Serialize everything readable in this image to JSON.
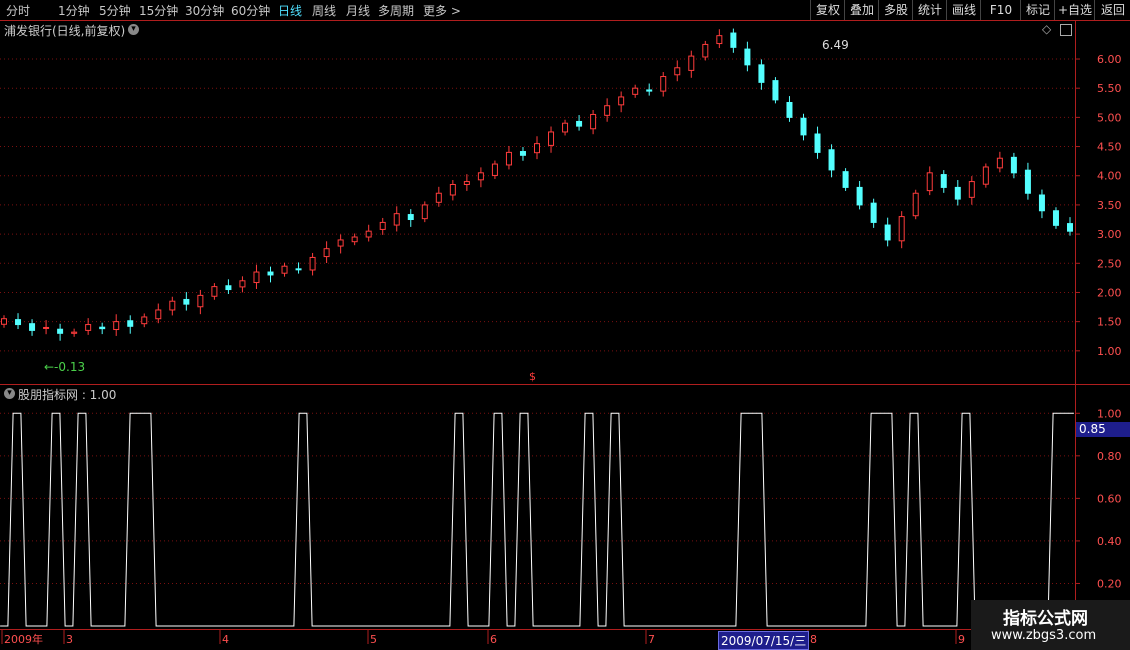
{
  "toolbar": {
    "periods": [
      {
        "label": "分时",
        "active": false
      },
      {
        "label": "1分钟",
        "active": false
      },
      {
        "label": "5分钟",
        "active": false
      },
      {
        "label": "15分钟",
        "active": false
      },
      {
        "label": "30分钟",
        "active": false
      },
      {
        "label": "60分钟",
        "active": false
      },
      {
        "label": "日线",
        "active": true
      },
      {
        "label": "周线",
        "active": false
      },
      {
        "label": "月线",
        "active": false
      },
      {
        "label": "多周期",
        "active": false
      }
    ],
    "more": "更多 >",
    "actions": [
      "复权",
      "叠加",
      "多股",
      "统计",
      "画线",
      "F10",
      "标记",
      "+自选",
      "返回"
    ]
  },
  "main_chart": {
    "title": "浦发银行(日线,前复权)",
    "high_label": "6.49",
    "low_label": "←-0.13",
    "marker": "$",
    "y_ticks": [
      "6.00",
      "5.50",
      "5.00",
      "4.50",
      "4.00",
      "3.50",
      "3.00",
      "2.50",
      "2.00",
      "1.50",
      "1.00"
    ]
  },
  "indicator": {
    "title": "股朋指标网 : 1.00",
    "current_value": "0.85",
    "y_ticks": [
      "1.00",
      "0.80",
      "0.60",
      "0.40",
      "0.20"
    ]
  },
  "time_axis": {
    "labels": [
      "2009年",
      "3",
      "4",
      "5",
      "6",
      "7",
      "8",
      "9"
    ],
    "cursor_label": "2009/07/15/三"
  },
  "watermark": {
    "line1": "指标公式网",
    "line2": "www.zbgs3.com"
  },
  "colors": {
    "up": "#ff3c3c",
    "down": "#54ffff",
    "grid": "#7a1010",
    "axis": "#b01e1e",
    "indicator_line": "#ffffff",
    "cursor_bg": "#1e1e8c"
  },
  "chart_data": [
    {
      "type": "candlestick",
      "title": "浦发银行(日线,前复权)",
      "ylim": [
        0.5,
        6.6
      ],
      "y_ticks": [
        1.0,
        1.5,
        2.0,
        2.5,
        3.0,
        3.5,
        4.0,
        4.5,
        5.0,
        5.5,
        6.0
      ],
      "annotations": {
        "max": 6.49,
        "min": -0.13
      },
      "closes": [
        1.55,
        1.45,
        1.35,
        1.4,
        1.3,
        1.32,
        1.45,
        1.38,
        1.5,
        1.42,
        1.58,
        1.7,
        1.85,
        1.8,
        1.95,
        2.1,
        2.05,
        2.2,
        2.35,
        2.3,
        2.45,
        2.4,
        2.6,
        2.75,
        2.9,
        2.95,
        3.05,
        3.2,
        3.35,
        3.25,
        3.5,
        3.7,
        3.85,
        3.9,
        4.05,
        4.2,
        4.4,
        4.35,
        4.55,
        4.75,
        4.9,
        4.85,
        5.05,
        5.2,
        5.35,
        5.5,
        5.45,
        5.7,
        5.85,
        6.05,
        6.25,
        6.4,
        6.2,
        5.9,
        5.6,
        5.3,
        5.0,
        4.7,
        4.4,
        4.1,
        3.8,
        3.5,
        3.2,
        2.9,
        3.3,
        3.7,
        4.05,
        3.8,
        3.6,
        3.9,
        4.15,
        4.3,
        4.05,
        3.7,
        3.4,
        3.15,
        3.05
      ],
      "x_labels": [
        "2009年",
        "3",
        "4",
        "5",
        "6",
        "7",
        "8",
        "9"
      ]
    },
    {
      "type": "line",
      "title": "股朋指标网",
      "ylim": [
        0,
        1.1
      ],
      "y_ticks": [
        0.2,
        0.4,
        0.6,
        0.8,
        1.0
      ],
      "series": [
        {
          "name": "股朋指标网",
          "values": [
            0,
            1,
            0,
            0,
            1,
            0,
            1,
            0,
            0,
            0,
            1,
            1,
            0,
            0,
            0,
            0,
            0,
            0,
            0,
            0,
            0,
            0,
            0,
            1,
            0,
            0,
            0,
            0,
            0,
            0,
            0,
            0,
            0,
            0,
            0,
            1,
            0,
            0,
            1,
            0,
            1,
            0,
            0,
            0,
            0,
            1,
            0,
            1,
            0,
            0,
            0,
            0,
            0,
            0,
            0,
            0,
            0,
            1,
            1,
            0,
            0,
            0,
            0,
            0,
            0,
            0,
            0,
            1,
            1,
            0,
            1,
            0,
            0,
            0,
            1,
            0,
            0,
            0,
            0,
            0,
            0,
            1,
            1
          ]
        }
      ],
      "last_value": 1.0,
      "current_value": 0.85
    }
  ]
}
